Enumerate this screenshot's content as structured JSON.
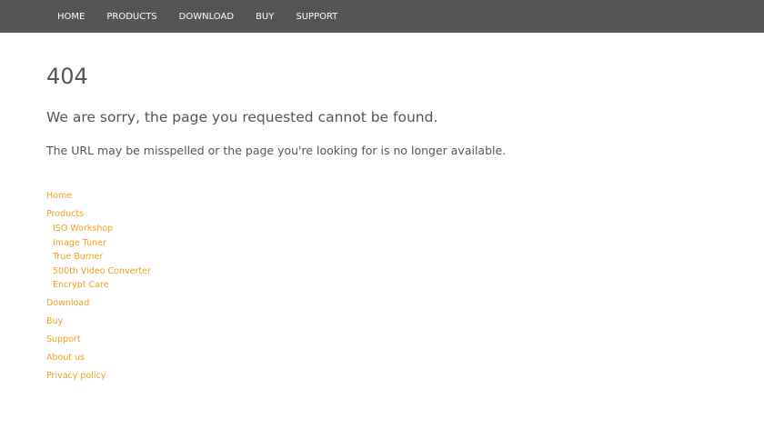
{
  "nav": {
    "items": [
      "HOME",
      "PRODUCTS",
      "DOWNLOAD",
      "BUY",
      "SUPPORT"
    ]
  },
  "error": {
    "code": "404",
    "headline": "We are sorry, the page you requested cannot be found.",
    "detail": "The URL may be misspelled or the page you're looking for is no longer available."
  },
  "sitemap": {
    "home": "Home",
    "products": "Products",
    "product_items": [
      "ISO Workshop",
      "Image Tuner",
      "True Burner",
      "500th Video Converter",
      "Encrypt Care"
    ],
    "download": "Download",
    "buy": "Buy",
    "support": "Support",
    "about": "About us",
    "privacy": "Privacy policy"
  },
  "colors": {
    "nav_bg": "#555555",
    "text": "#555555",
    "link": "#f0a020"
  }
}
